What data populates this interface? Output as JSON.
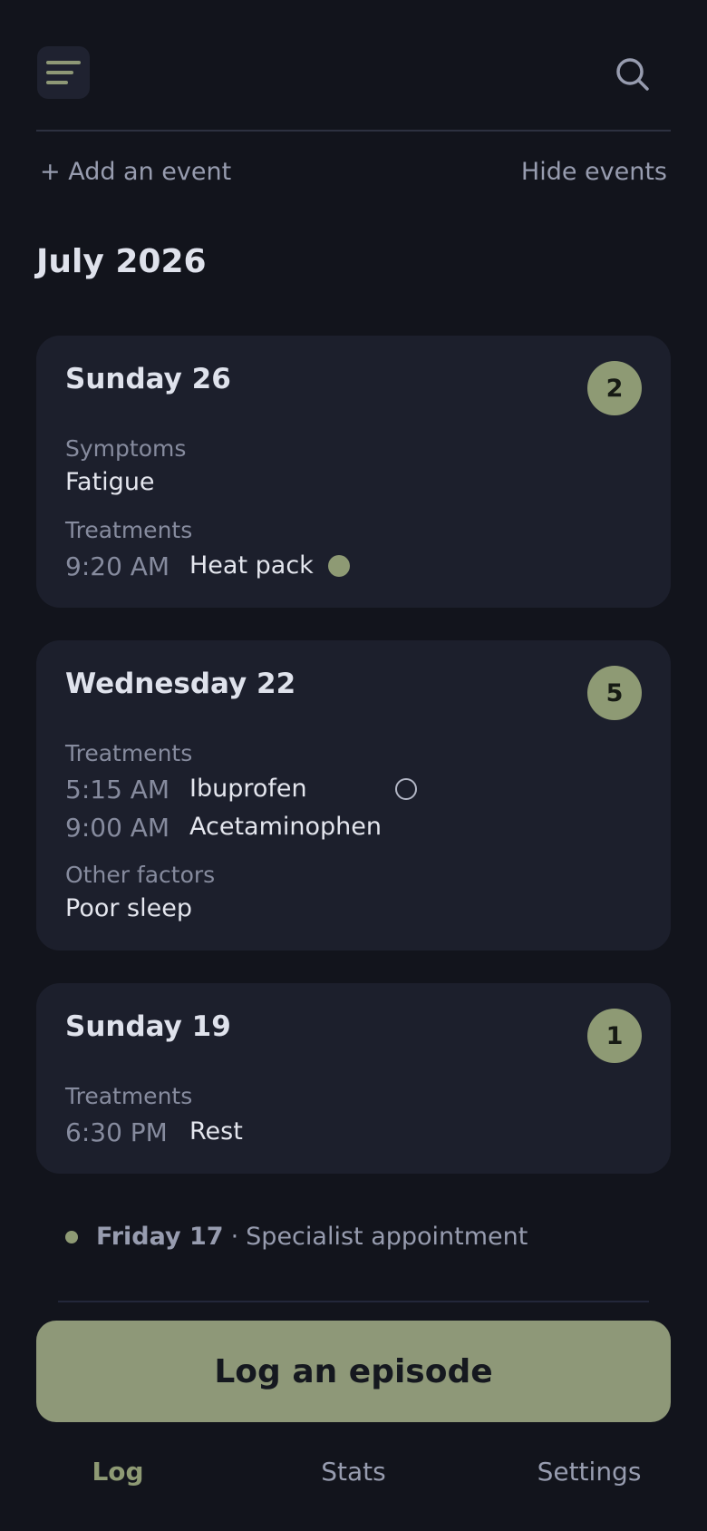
{
  "header": {
    "menu_icon": "menu-icon",
    "search_icon": "search-icon"
  },
  "actions": {
    "add_event": "+ Add an event",
    "hide_events": "Hide events"
  },
  "month": "July 2026",
  "cards": [
    {
      "title": "Sunday 26",
      "count": "2",
      "symptoms_label": "Symptoms",
      "symptoms_value": "Fatigue",
      "treatments_label": "Treatments",
      "treatments": [
        {
          "time": "9:20 AM",
          "name": "Heat pack",
          "marker": "filled"
        }
      ]
    },
    {
      "title": "Wednesday 22",
      "count": "5",
      "treatments_label": "Treatments",
      "treatments": [
        {
          "time": "5:15 AM",
          "name": "Ibuprofen",
          "marker": "ring"
        },
        {
          "time": "9:00 AM",
          "name": "Acetaminophen"
        }
      ],
      "other_label": "Other factors",
      "other_value": "Poor sleep"
    },
    {
      "title": "Sunday 19",
      "count": "1",
      "treatments_label": "Treatments",
      "treatments": [
        {
          "time": "6:30 PM",
          "name": "Rest"
        }
      ]
    }
  ],
  "event": {
    "day": "Friday 17",
    "separator": "·",
    "name": "Specialist appointment"
  },
  "log_button": "Log an episode",
  "tabs": [
    {
      "label": "Log",
      "active": true
    },
    {
      "label": "Stats"
    },
    {
      "label": "Settings"
    }
  ],
  "colors": {
    "accent": "#8e9a74",
    "background": "#12141c",
    "card": "#1c1f2c"
  }
}
